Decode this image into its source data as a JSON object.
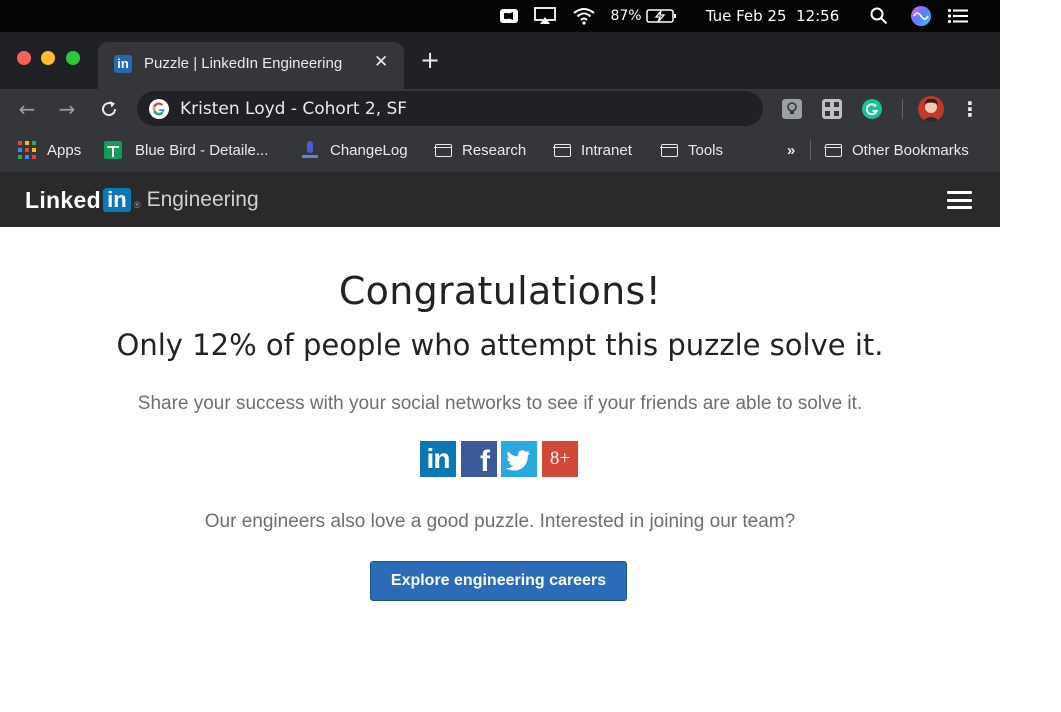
{
  "menubar": {
    "battery": "87%",
    "datetime": "Tue Feb 25  12:56"
  },
  "browser": {
    "tab": {
      "favicon_text": "in",
      "title": "Puzzle | LinkedIn Engineering",
      "close": "✕"
    },
    "new_tab": "+",
    "nav": {
      "back": "←",
      "forward": "→",
      "reload": "C"
    },
    "omnibox_text": "Kristen Loyd - Cohort 2, SF",
    "more": "⋮",
    "bookmarks": {
      "apps": "Apps",
      "items": [
        "Blue Bird - Detaile...",
        "ChangeLog",
        "Research",
        "Intranet",
        "Tools"
      ],
      "overflow": "»",
      "other": "Other Bookmarks"
    }
  },
  "site": {
    "logo_linked": "Linked",
    "logo_in": "in",
    "logo_reg": "®",
    "logo_engineering": "Engineering"
  },
  "main": {
    "heading": "Congratulations!",
    "subheading": "Only 12% of people who attempt this puzzle solve it.",
    "share_text": "Share your success with your social networks to see if your friends are able to solve it.",
    "social": {
      "linkedin": "in",
      "facebook": "f",
      "googleplus": "8+"
    },
    "join_text": "Our engineers also love a good puzzle. Interested in joining our team?",
    "cta_label": "Explore engineering careers"
  },
  "colors": {
    "linkedin_blue": "#0b77b5",
    "facebook_blue": "#3b5998",
    "twitter_blue": "#2aa9e0",
    "googleplus_red": "#d34836",
    "cta_blue": "#2b6bb8"
  }
}
